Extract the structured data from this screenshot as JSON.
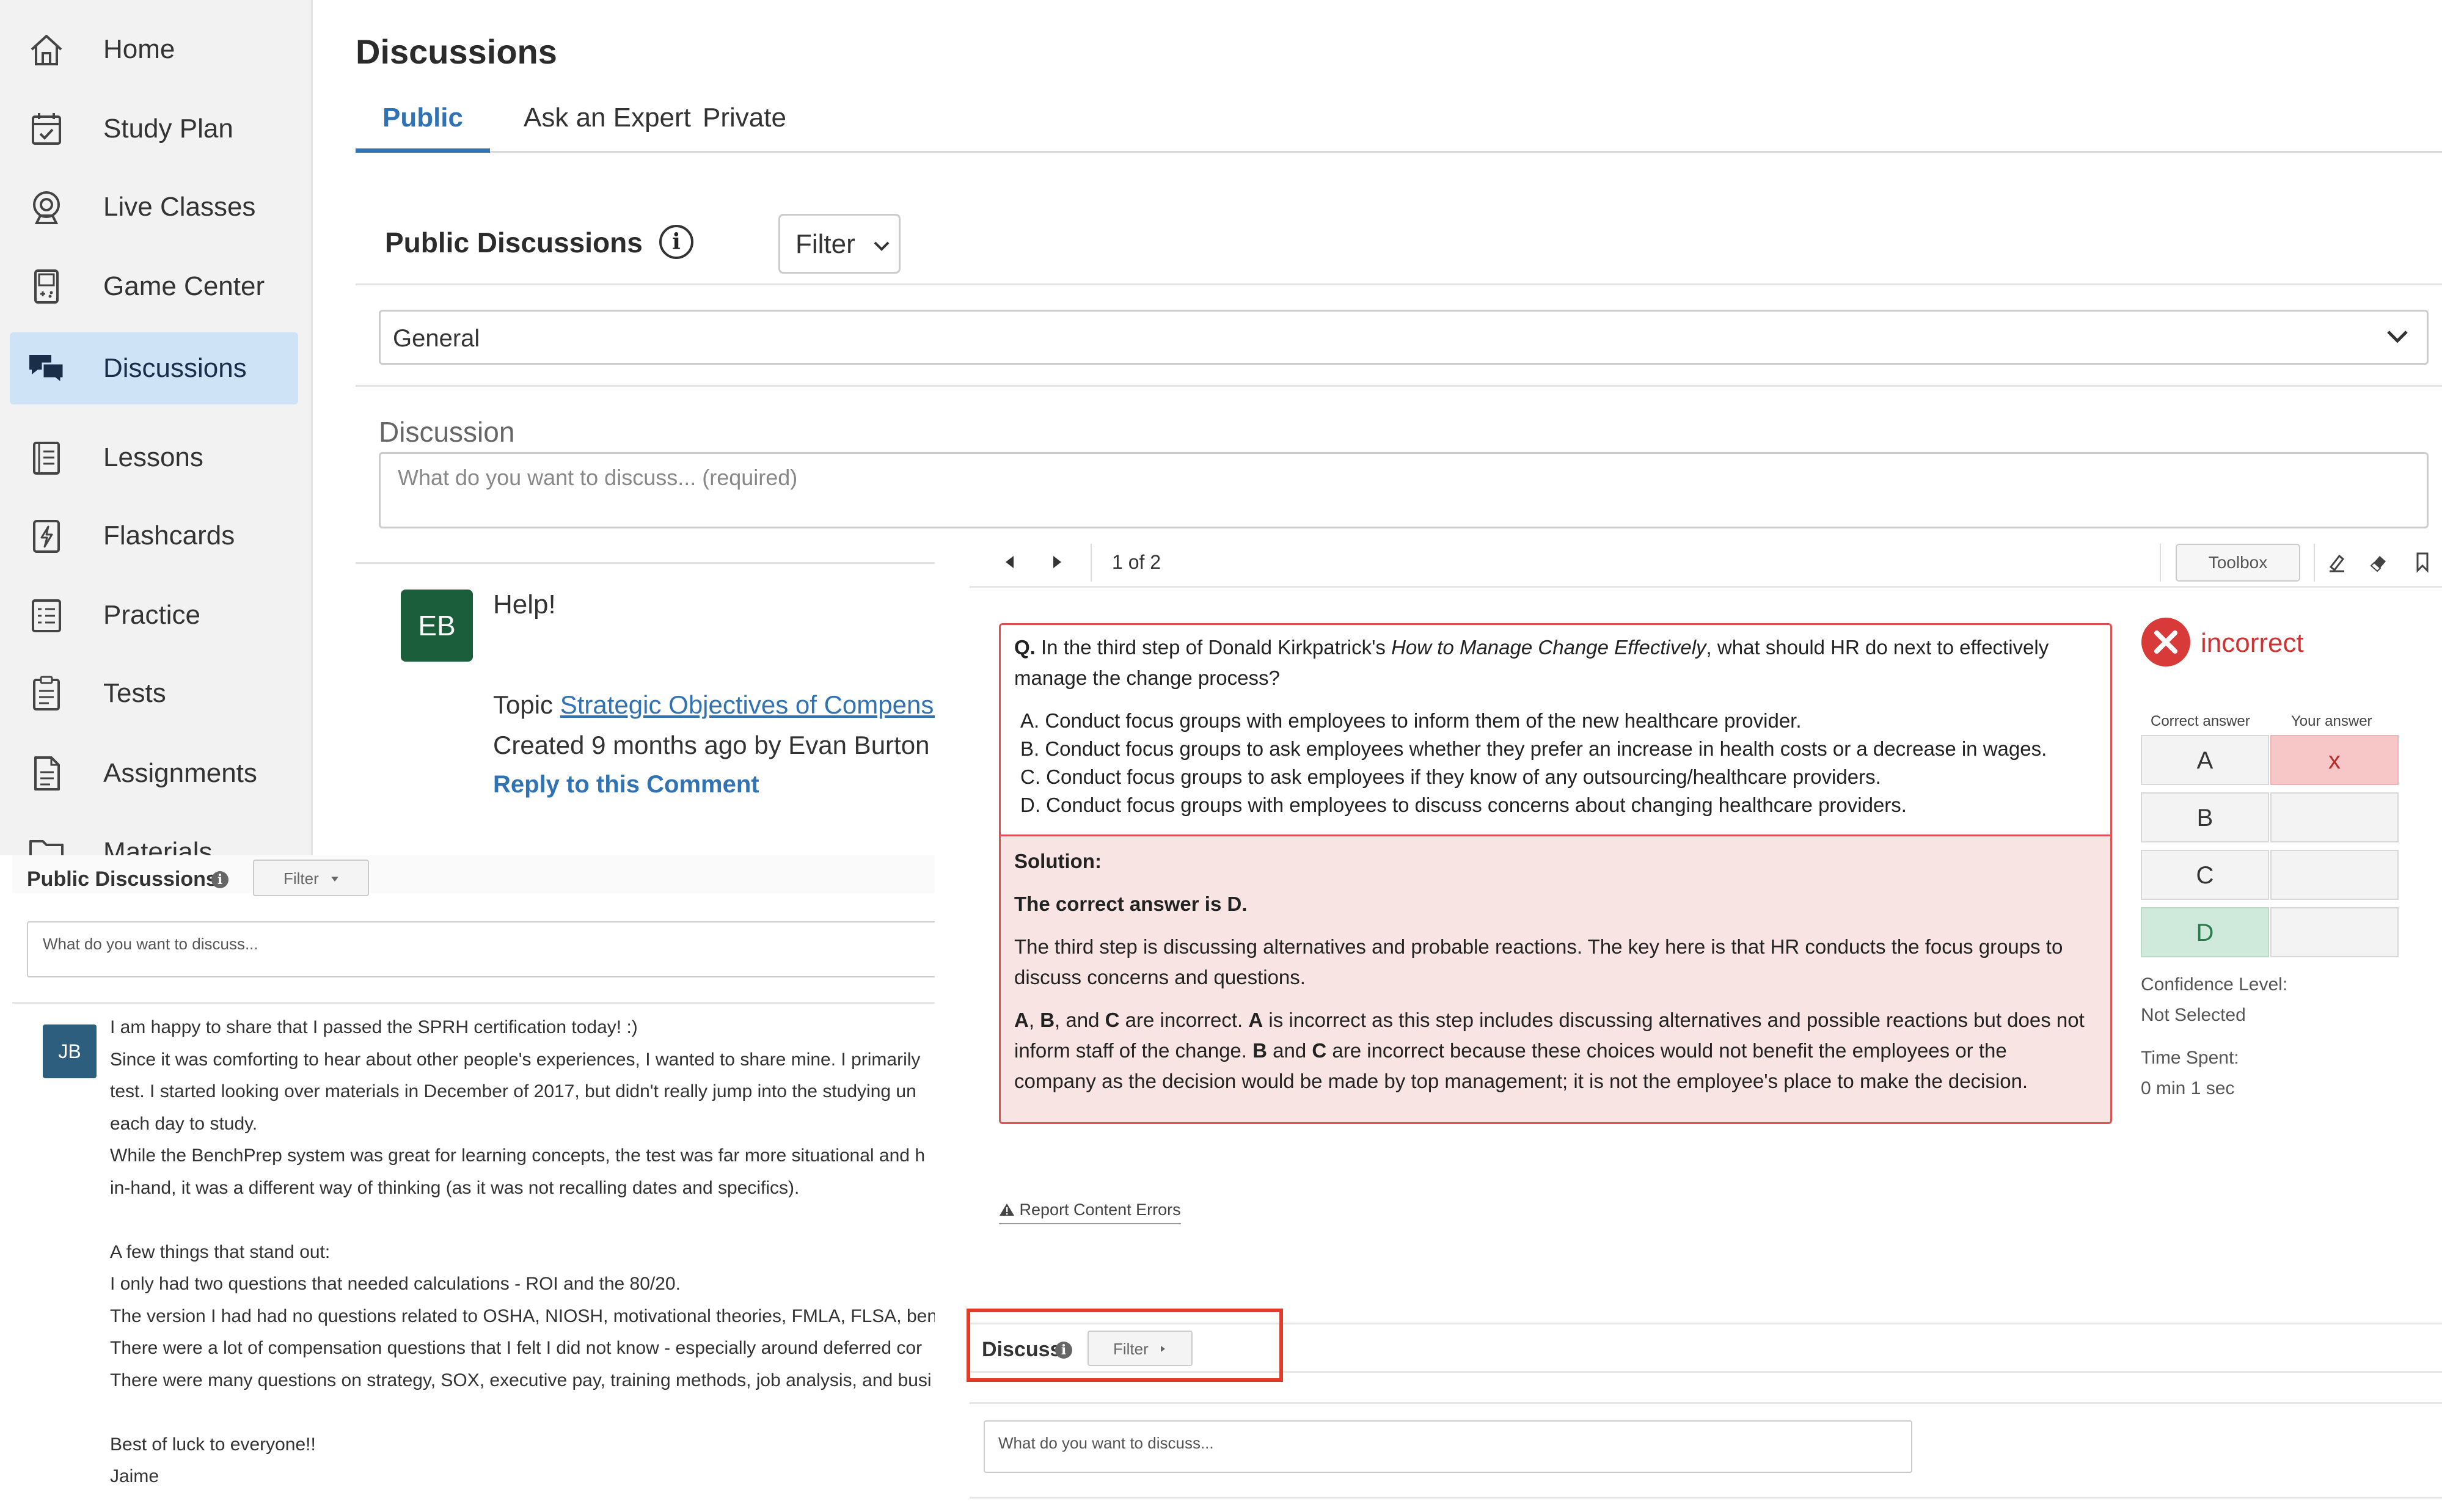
{
  "sidebar": {
    "items": [
      {
        "label": "Home",
        "icon": "home-icon"
      },
      {
        "label": "Study Plan",
        "icon": "calendar-check-icon"
      },
      {
        "label": "Live Classes",
        "icon": "webcam-icon"
      },
      {
        "label": "Game Center",
        "icon": "gamepad-icon"
      },
      {
        "label": "Discussions",
        "icon": "chat-bubbles-icon",
        "active": true
      },
      {
        "label": "Lessons",
        "icon": "book-icon"
      },
      {
        "label": "Flashcards",
        "icon": "flashcard-icon"
      },
      {
        "label": "Practice",
        "icon": "checklist-icon"
      },
      {
        "label": "Tests",
        "icon": "clipboard-icon"
      },
      {
        "label": "Assignments",
        "icon": "document-icon"
      },
      {
        "label": "Materials",
        "icon": "folder-icon"
      }
    ]
  },
  "header": {
    "title": "Discussions",
    "tabs": [
      {
        "label": "Public",
        "active": true
      },
      {
        "label": "Ask an Expert"
      },
      {
        "label": "Private"
      }
    ]
  },
  "public_form": {
    "title": "Public Discussions",
    "info_glyph": "i",
    "filter_label": "Filter",
    "category_value": "General",
    "discussion_label": "Discussion",
    "discussion_placeholder": "What do you want to discuss... (required)"
  },
  "comment": {
    "avatar_initials": "EB",
    "title": "Help!",
    "topic_prefix": "Topic",
    "topic_link": "Strategic Objectives of Compensati",
    "created": "Created 9 months ago by Evan Burton",
    "reply_label": "Reply to this Comment"
  },
  "overlay_public": {
    "title": "Public Discussions",
    "info_glyph": "i",
    "filter_label": "Filter",
    "input_placeholder": "What do you want to discuss...",
    "post": {
      "avatar_initials": "JB",
      "lines": [
        "I am happy to share that I passed the SPRH certification today! :)",
        "Since it was comforting to hear about other people's experiences, I wanted to share mine. I primarily",
        "test. I started looking over materials in December of 2017, but didn't really jump into the studying un",
        "each day to study.",
        "While the BenchPrep system was great for learning concepts, the test was far more situational and h",
        "in-hand, it was a different way of thinking (as it was not recalling dates and specifics).",
        "",
        "A few things that stand out:",
        "I only had two questions that needed calculations - ROI and the 80/20.",
        "The version I had had no questions related to OSHA, NIOSH, motivational theories, FMLA, FLSA, bene",
        "There were a lot of compensation questions that I felt I did not know - especially around deferred cor",
        "There were many questions on strategy, SOX, executive pay, training methods, job analysis, and busi",
        "",
        "Best of luck to everyone!!",
        "Jaime"
      ]
    }
  },
  "question_panel": {
    "pagination": "1 of 2",
    "toolbox_label": "Toolbox",
    "question": {
      "prefix": "Q.",
      "text_before": " In the third step of Donald Kirkpatrick's ",
      "text_italic": "How to Manage Change Effectively",
      "text_after": ", what should HR do next to effectively",
      "text_line2": "manage the change process?",
      "options": [
        "A. Conduct focus groups with employees to inform them of the new healthcare provider.",
        "B. Conduct focus groups to ask employees whether they prefer an increase in health costs or a decrease in wages.",
        "C. Conduct focus groups to ask employees if they know of any outsourcing/healthcare providers.",
        "D. Conduct focus groups with employees to discuss concerns about changing healthcare providers."
      ]
    },
    "solution": {
      "heading": "Solution:",
      "answer": "The correct answer is D.",
      "para1_line1": "The third step is discussing alternatives and probable reactions. The key here is that HR conducts the focus groups to",
      "para1_line2": "discuss concerns and questions.",
      "para2_line1": {
        "b1": "A",
        "t1": ", ",
        "b2": "B",
        "t2": ", and ",
        "b3": "C",
        "t3": " are incorrect. ",
        "b4": "A",
        "t4": " is incorrect as this step includes discussing alternatives and possible reactions but does not"
      },
      "para2_line2": {
        "t1": "inform staff of the change. ",
        "b1": "B",
        "t2": " and ",
        "b2": "C",
        "t3": " are incorrect because these choices would not benefit the employees or the"
      },
      "para2_line3": "company as the decision would be made by top management; it is not the employee's place to make the decision."
    },
    "result": {
      "status": "incorrect",
      "correct_answer_label": "Correct answer",
      "your_answer_label": "Your answer",
      "choices": [
        "A",
        "B",
        "C",
        "D"
      ],
      "correct_choice": "D",
      "your_choice": "A",
      "your_mark": "x",
      "confidence_label": "Confidence Level:",
      "confidence_value": "Not Selected",
      "time_label": "Time Spent:",
      "time_value": "0 min 1 sec"
    },
    "report_label": "Report Content Errors",
    "report_icon": "warning-icon"
  },
  "discuss_section": {
    "title": "Discuss",
    "info_glyph": "i",
    "filter_label": "Filter",
    "input_placeholder": "What do you want to discuss..."
  },
  "colors": {
    "accent_blue": "#2f73b5",
    "active_nav_bg": "#cfe3f6",
    "incorrect_red": "#cc3333",
    "solution_bg": "#f9e4e4",
    "correct_green_bg": "#cfeadb",
    "highlight_red": "#e23b2e"
  }
}
